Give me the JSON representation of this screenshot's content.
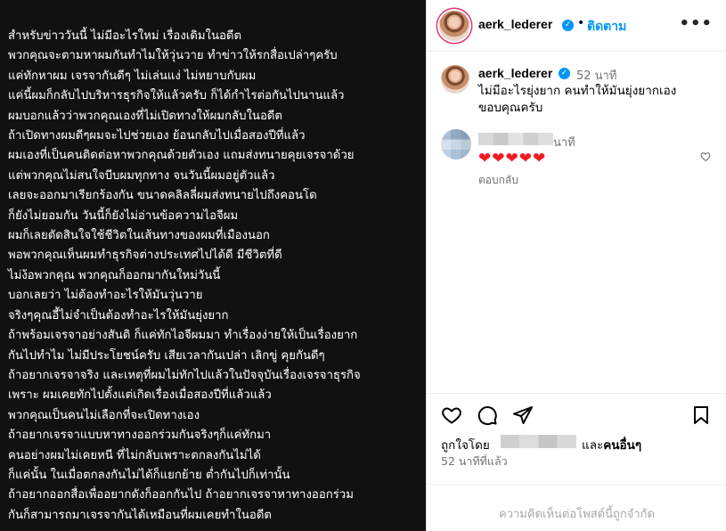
{
  "post": {
    "lines": [
      "สำหรับข่าววันนี้ ไม่มีอะไรใหม่ เรื่องเดิมในอดีต",
      "พวกคุณจะตามหาผมกันทำไมให้วุ่นวาย ทำข่าวให้รกสื่อเปล่าๆครับ",
      "แค่ทักหาผม เจรจากันดีๆ ไม่เล่นแง่ ไม่หยาบกับผม",
      "แค่นี้ผมก็กลับไปบริหารธุรกิจให้แล้วครับ ก็ได้กำไรต่อกันไปนานแล้ว",
      "ผมบอกแล้วว่าพวกคุณเองที่ไม่เปิดทางให้ผมกลับในอดีต",
      "ถ้าเปิดทางผมดีๆผมจะไปช่วยเอง ย้อนกลับไปเมื่อสองปีที่แล้ว",
      "ผมเองที่เป็นคนติดต่อหาพวกคุณด้วยตัวเอง แถมส่งทนายคุยเจรจาด้วย",
      "แต่พวกคุณไม่สนใจบีบผมทุกทาง จนวันนี้ผมอยู่ตัวแล้ว",
      "เลยจะออกมาเรียกร้องกัน ขนาดคลิลลี่ผมส่งทนายไปถึงคอนโด",
      "ก็ยังไม่ยอมกัน วันนี้ก็ยังไม่อ่านข้อความไอจีผม",
      "ผมก็เลยตัดสินใจใช้ชีวิตในเส้นทางของผมที่เมืองนอก",
      "พอพวกคุณเห็นผมทำธุรกิจต่างประเทศไปได้ดี มีชีวิตที่ดี",
      "ไม่ง้อพวกคุณ พวกคุณก็ออกมากันใหม่วันนี้",
      "บอกเลยว่า ไม่ต้องทำอะไรให้มันวุ่นวาย",
      "จริงๆคุณอี้ไม่จำเป็นต้องทำอะไรให้มันยุ่งยาก",
      "ถ้าพร้อมเจรจาอย่างสันติ ก็แค่ทักไอจีผมมา ทำเรื่องง่ายให้เป็นเรื่องยาก",
      "กันไปทำไม ไม่มีประโยชน์ครับ เสียเวลากันเปล่า เลิกขู่ คุยกันดีๆ",
      "ถ้าอยากเจรจาจริง และเหตุที่ผมไม่ทักไปแล้วในปัจจุบันเรื่องเจรจาธุรกิจ",
      "เพราะ ผมเคยทักไปตั้งแต่เกิดเรื่องเมื่อสองปีที่แล้วแล้ว",
      "พวกคุณเป็นคนไม่เลือกที่จะเปิดทางเอง",
      "ถ้าอยากเจรจาแบบหาทางออกร่วมกันจริงๆก็แค่ทักมา",
      "คนอย่างผมไม่เคยหนี ที่ไม่กลับเพราะตกลงกันไม่ได้",
      "ก็แค่นั้น ในเมื่อตกลงกันไม่ได้ก็แยกย้าย ต่ำกันไปก็เท่านั้น",
      "ถ้าอยากออกสื่อเพื่ออยากดังก็ออกกันไป ถ้าอยากเจรจาหาทางออกร่วม",
      "กันก็สามารถมาเจรจากันได้เหมือนที่ผมเคยทำในอดีต"
    ],
    "text": ""
  },
  "header": {
    "username": "aerk_lederer",
    "dot": "•",
    "follow_label": "ติดตาม",
    "more_label": "•••"
  },
  "caption": {
    "username": "aerk_lederer",
    "time": "52 นาที",
    "text": "ไม่มีอะไรยุ่งยาก คนทำให้มันยุ่งยากเอง ขอบคุณครับ"
  },
  "comment": {
    "time": "นาที",
    "hearts": "❤❤❤❤❤",
    "reply_label": "ตอบกลับ"
  },
  "likes": {
    "prefix": "ถูกใจโดย",
    "and": "และ",
    "others": "คนอื่นๆ"
  },
  "post_time": "52 นาทีที่แล้ว",
  "comments_limited": "ความคิดเห็นต่อโพสต์นี้ถูกจำกัด",
  "colors": {
    "media_bg": "#111111",
    "accent": "#0095f6",
    "heart": "#ed1c24",
    "muted": "#737373"
  },
  "icons": [
    "heart-icon",
    "comment-icon",
    "share-icon",
    "bookmark-icon",
    "verified-badge-icon"
  ]
}
